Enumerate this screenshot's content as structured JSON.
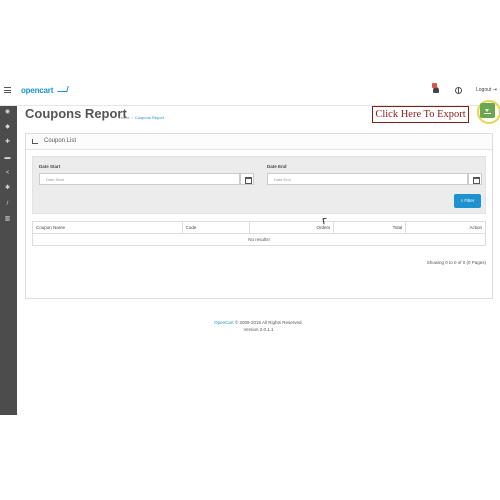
{
  "header": {
    "logo_text": "opencart",
    "logout_label": "Logout"
  },
  "sidebar": {
    "items": [
      {
        "icon": "dashboard-icon"
      },
      {
        "icon": "tag-icon"
      },
      {
        "icon": "puzzle-icon"
      },
      {
        "icon": "cart-icon"
      },
      {
        "icon": "share-icon"
      },
      {
        "icon": "gear-icon"
      },
      {
        "icon": "wrench-icon"
      },
      {
        "icon": "bar-chart-icon"
      }
    ]
  },
  "page": {
    "title": "Coupons Report",
    "breadcrumb": [
      "Home",
      "Coupons Report"
    ],
    "export_label": "Click Here To Export"
  },
  "panel": {
    "title": "Coupon List",
    "date_start_label": "Date Start",
    "date_start_placeholder": "Date Start",
    "date_end_label": "Date End",
    "date_end_placeholder": "Date End",
    "filter_label": "Filter"
  },
  "table": {
    "columns": [
      "Coupon Name",
      "Code",
      "Orders",
      "Total",
      "Action"
    ],
    "empty_text": "No results!",
    "showing_text": "Showing 0 to 0 of 0 (0 Pages)"
  },
  "footer": {
    "link": "OpenCart",
    "copyright": "© 2009-2015 All Rights Reserved.",
    "version": "Version 2.0.1.1"
  },
  "colors": {
    "brand": "#1e91cf",
    "sidebar_bg": "#4c4c4c",
    "export_button": "#6aa84f",
    "export_label": "#8b1a1a",
    "highlight_ring": "#e8d44d"
  }
}
